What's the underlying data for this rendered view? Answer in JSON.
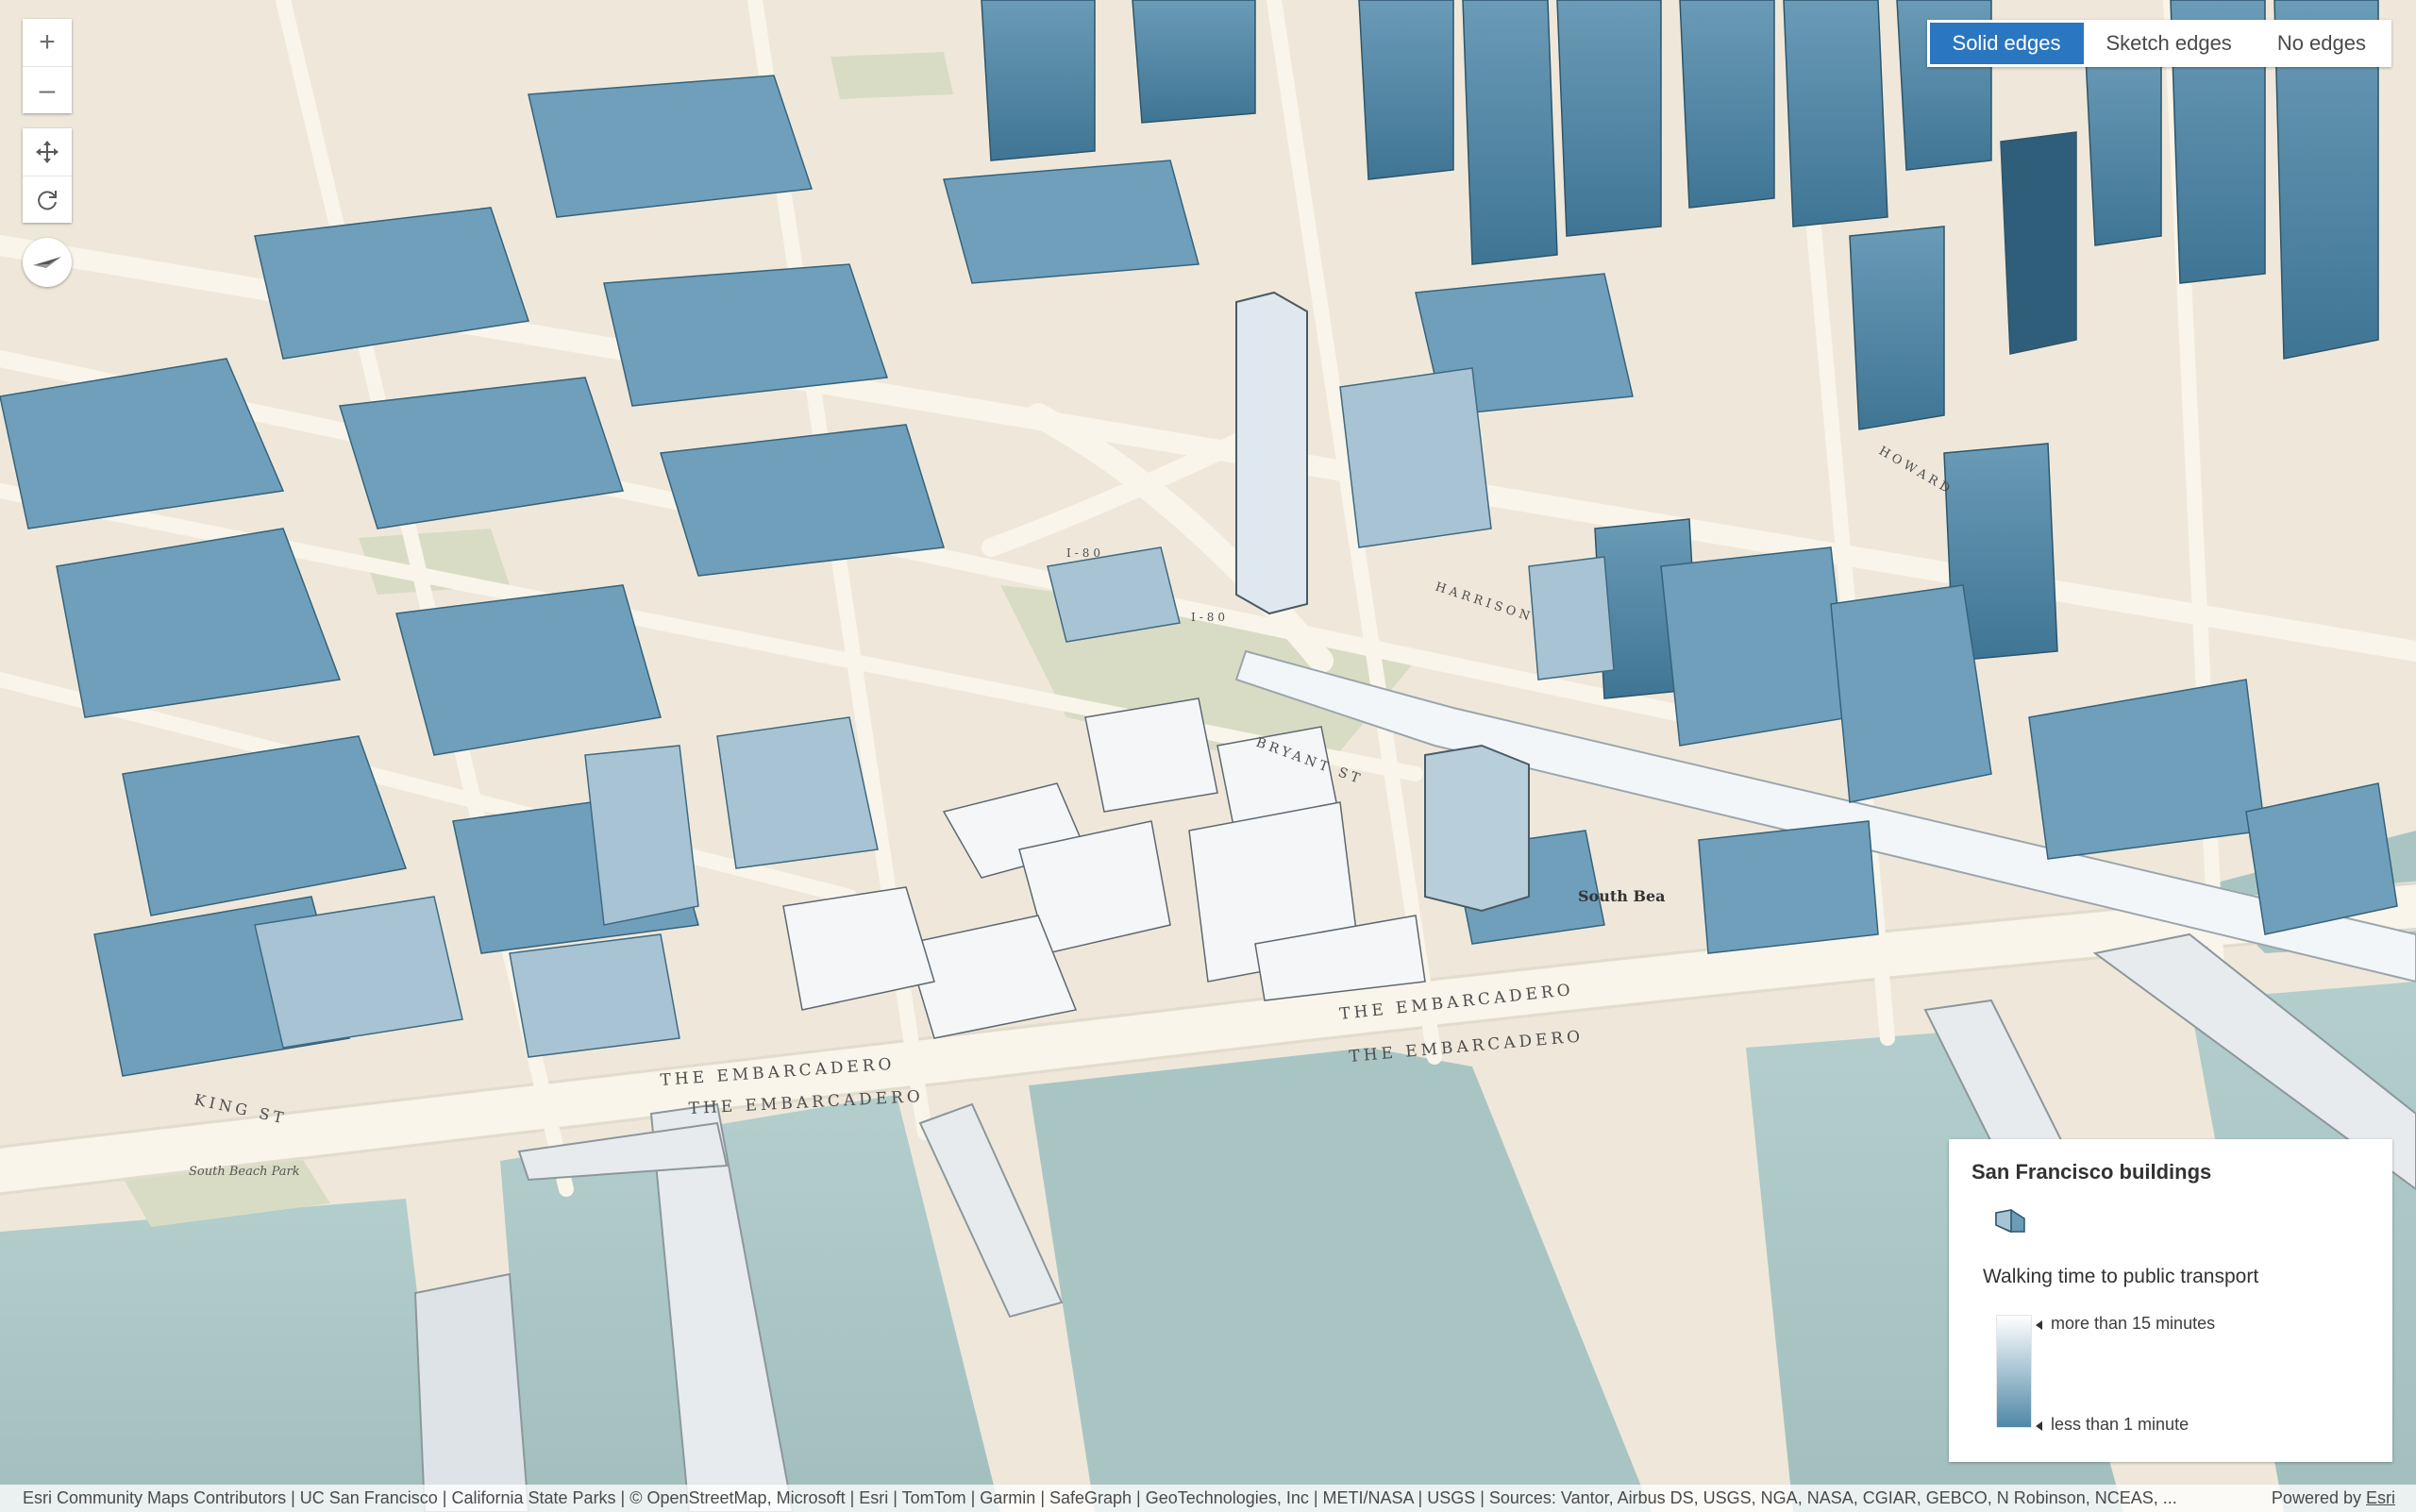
{
  "map": {
    "labels": {
      "embarcadero_1": "THE EMBARCADERO",
      "embarcadero_2": "THE EMBARCADERO",
      "embarcadero_3": "THE EMBARCADERO",
      "embarcadero_4": "THE EMBARCADERO",
      "king_st": "KING ST",
      "bryant_st": "BRYANT ST",
      "harrison": "HARRISON",
      "howard": "HOWARD",
      "south_beach": "South Bea",
      "south_beach_park": "South Beach Park",
      "i80_1": "I-80",
      "i80_2": "I-80"
    },
    "colors": {
      "water": "#aac6c4",
      "land": "#efe8da",
      "road": "#f7f1e4",
      "building_tall": "#4e86a5",
      "building_low": "#ffffff"
    }
  },
  "navigation": {
    "zoom_in": "+",
    "zoom_out": "–",
    "pan_icon": "move-icon",
    "rotate_icon": "rotate-icon",
    "compass_icon": "compass-icon"
  },
  "edge_toggle": {
    "options": [
      "Solid edges",
      "Sketch edges",
      "No edges"
    ],
    "selected": "Solid edges"
  },
  "legend": {
    "layer_title": "San Francisco buildings",
    "field_title": "Walking time to public transport",
    "stops": [
      "more than 15 minutes",
      "less than 1 minute"
    ],
    "ramp_colors": [
      "#ffffff",
      "#4f88a6"
    ]
  },
  "attribution": {
    "text": "Esri Community Maps Contributors | UC San Francisco | California State Parks | © OpenStreetMap, Microsoft | Esri | TomTom | Garmin | SafeGraph | GeoTechnologies, Inc | METI/NASA | USGS | Sources: Vantor, Airbus DS, USGS, NGA, NASA, CGIAR, GEBCO, N Robinson, NCEAS, ...",
    "powered_by": "Powered by",
    "esri": "Esri"
  }
}
